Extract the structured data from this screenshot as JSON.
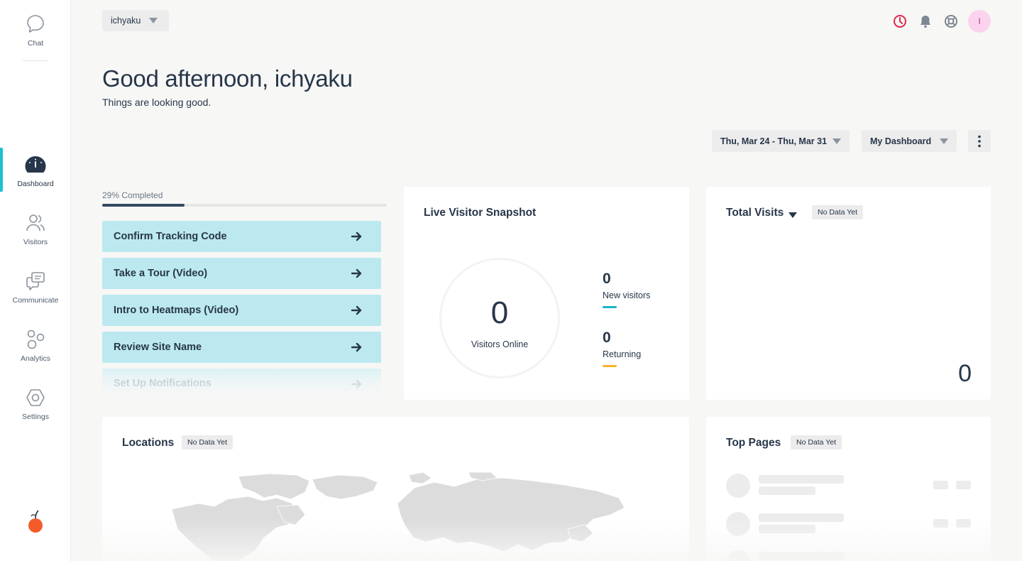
{
  "sidebar": {
    "items": [
      {
        "label": "Chat",
        "icon": "chat-bubble-icon"
      },
      {
        "label": "Dashboard",
        "icon": "speedometer-icon"
      },
      {
        "label": "Visitors",
        "icon": "users-icon"
      },
      {
        "label": "Communicate",
        "icon": "messages-icon"
      },
      {
        "label": "Analytics",
        "icon": "circles-icon"
      },
      {
        "label": "Settings",
        "icon": "hexagon-gear-icon"
      }
    ],
    "active": "Dashboard",
    "logo_icon": "orange-fruit-icon"
  },
  "topbar": {
    "site_name": "ichyaku",
    "icons": [
      "clock-alert-icon",
      "bell-icon",
      "help-lifebuoy-icon"
    ],
    "avatar_initial": "I"
  },
  "greeting": {
    "title": "Good afternoon, ichyaku",
    "subtitle": "Things are looking good."
  },
  "controls": {
    "date_range": "Thu, Mar 24 - Thu, Mar 31",
    "dashboard": "My Dashboard"
  },
  "checklist": {
    "progress_label": "29% Completed",
    "progress": 0.29,
    "tasks": [
      "Confirm Tracking Code",
      "Take a Tour (Video)",
      "Intro to Heatmaps (Video)",
      "Review Site Name",
      "Set Up Notifications"
    ]
  },
  "live_snapshot": {
    "title": "Live Visitor Snapshot",
    "online_count": "0",
    "online_label": "Visitors Online",
    "new_count": "0",
    "new_label": "New visitors",
    "returning_count": "0",
    "returning_label": "Returning"
  },
  "total_visits": {
    "title": "Total Visits",
    "badge": "No Data Yet",
    "value": "0"
  },
  "locations": {
    "title": "Locations",
    "badge": "No Data Yet"
  },
  "top_pages": {
    "title": "Top Pages",
    "badge": "No Data Yet"
  },
  "colors": {
    "accent": "#1cc0d2",
    "new_visitors": "#1ab3c9",
    "returning": "#f5b623",
    "task_bg": "#bce9f0",
    "progress": "#34495e",
    "alert": "#e0264a"
  }
}
